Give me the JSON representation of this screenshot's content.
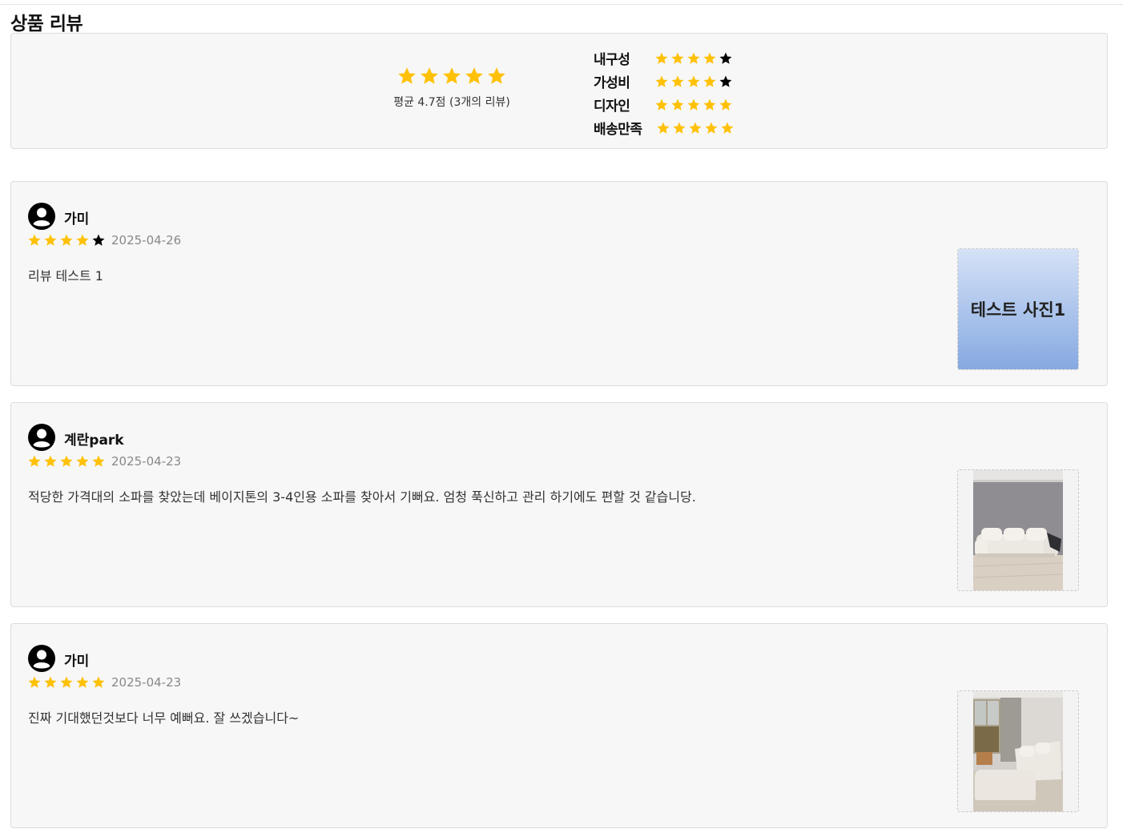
{
  "page": {
    "title": "상품 리뷰"
  },
  "colors": {
    "star_filled": "#FFC107",
    "star_empty": "#000000",
    "panel_bg": "#F7F7F7",
    "border": "#DCDCDC"
  },
  "summary": {
    "overall_rating": 5,
    "average_text": "평균 4.7점 (3개의 리뷰)",
    "criteria": [
      {
        "label": "내구성",
        "rating": 4
      },
      {
        "label": "가성비",
        "rating": 4
      },
      {
        "label": "디자인",
        "rating": 5
      },
      {
        "label": "배송만족",
        "rating": 5
      }
    ]
  },
  "reviews": [
    {
      "author": "가미",
      "avatar_icon": "user-circle-icon",
      "rating": 4,
      "date": "2025-04-26",
      "text": "리뷰 테스트 1",
      "photo_label": "테스트 사진1",
      "photo_type": "placeholder"
    },
    {
      "author": "계란park",
      "avatar_icon": "user-circle-icon",
      "rating": 5,
      "date": "2025-04-23",
      "text": "적당한 가격대의 소파를 찾았는데 베이지톤의 3-4인용 소파를 찾아서 기뻐요. 엄청 푹신하고 관리 하기에도 편할 것 같습니당.",
      "photo_type": "sofa-photo"
    },
    {
      "author": "가미",
      "avatar_icon": "user-circle-icon",
      "rating": 5,
      "date": "2025-04-23",
      "text": "진짜 기대했던것보다 너무 예뻐요. 잘 쓰겠습니다~",
      "photo_type": "sofa-corner-photo"
    }
  ]
}
